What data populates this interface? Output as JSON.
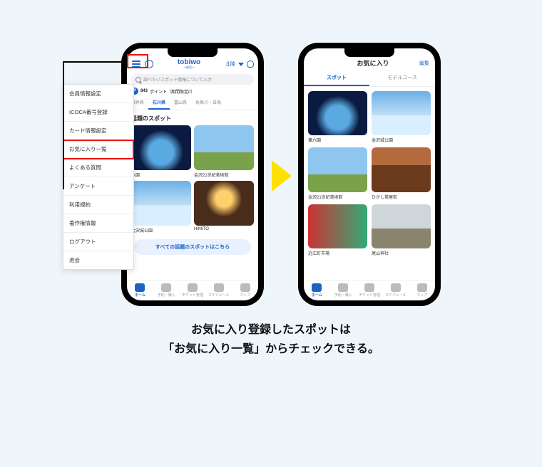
{
  "caption_line1": "お気に入り登録したスポットは",
  "caption_line2": "「お気に入り一覧」からチェックできる。",
  "menu": {
    "items": [
      "会員情報設定",
      "ICOCA番号登録",
      "カード情報設定",
      "お気に入り一覧",
      "よくある質問",
      "アンケート",
      "利用規約",
      "著作権情報",
      "ログアウト",
      "退会"
    ],
    "highlighted_index": 3
  },
  "left_phone": {
    "brand": "tobiwo",
    "subbrand": "ー旅活ー",
    "region": "北陸",
    "search_placeholder": "調べたいスポット情報について入力",
    "points_badge": "P",
    "points_value": "843",
    "points_suffix": "ポイント（期間限定0）",
    "area_tabs": [
      "福井県",
      "石川県",
      "富山県",
      "糸魚川・自馬"
    ],
    "area_active_index": 1,
    "section_title_suffix": "話題のスポット",
    "spots": [
      {
        "name": "六園",
        "style": "night"
      },
      {
        "name": "金沢21世紀美術館",
        "style": "field"
      },
      {
        "name": "金沢城公園",
        "style": "sky"
      },
      {
        "name": "HIMITO",
        "style": "room"
      }
    ],
    "more_button": "すべての話題のスポットはこちら",
    "tabbar": [
      "ホーム",
      "予約・購入",
      "チケット管理",
      "スケジュール",
      "マップ"
    ],
    "tabbar_active_index": 0
  },
  "right_phone": {
    "title": "お気に入り",
    "edit": "編集",
    "segments": [
      "スポット",
      "モデルコース"
    ],
    "segment_active_index": 0,
    "favorites": [
      {
        "name": "兼六園",
        "style": "night"
      },
      {
        "name": "金沢城公園",
        "style": "sky"
      },
      {
        "name": "金沢21世紀美術館",
        "style": "field"
      },
      {
        "name": "ひがし茶屋街",
        "style": "street"
      },
      {
        "name": "近江町市場",
        "style": "market"
      },
      {
        "name": "尾山神社",
        "style": "shrine"
      }
    ],
    "tabbar": [
      "ホーム",
      "予約・購入",
      "チケット管理",
      "スケジュール",
      "マップ"
    ],
    "tabbar_active_index": 0
  }
}
